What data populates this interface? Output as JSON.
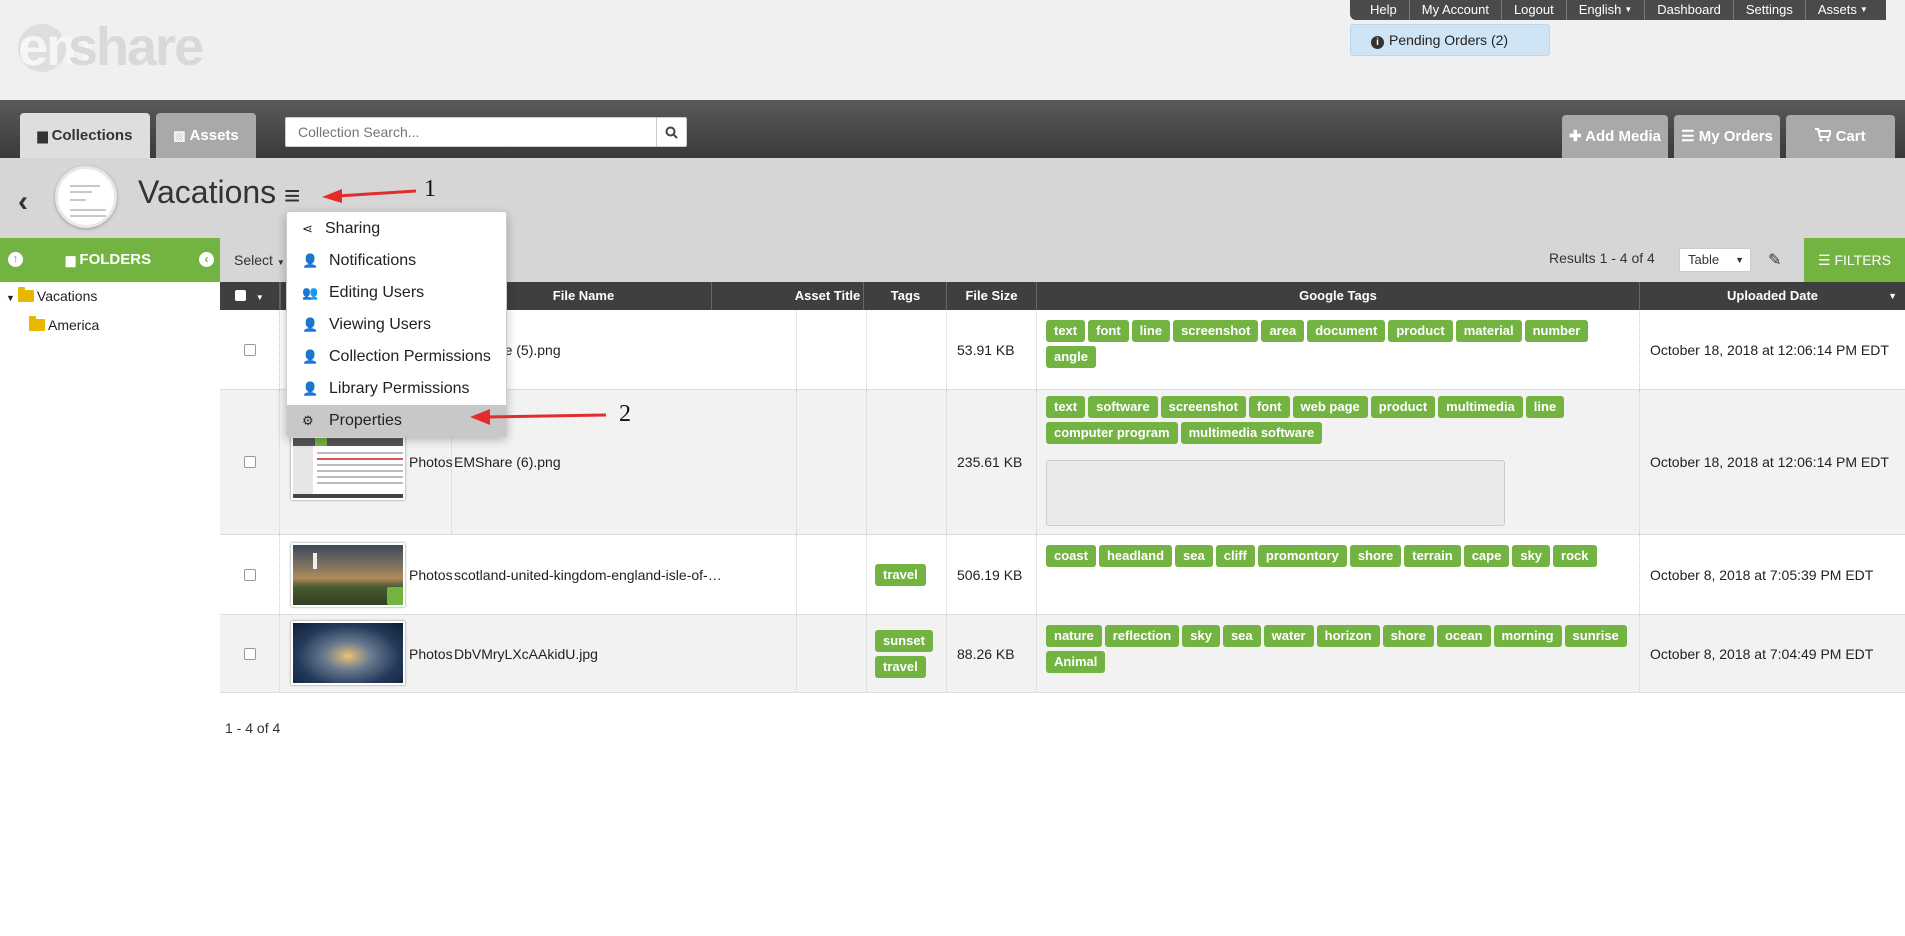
{
  "brand": {
    "logo_text": "share",
    "logo_e": "em"
  },
  "topnav": {
    "items": [
      {
        "label": "Help"
      },
      {
        "label": "My Account"
      },
      {
        "label": "Logout"
      },
      {
        "label": "English"
      },
      {
        "label": "Dashboard"
      },
      {
        "label": "Settings"
      },
      {
        "label": "Assets"
      }
    ],
    "pending_orders": "Pending Orders (2)"
  },
  "toolbar": {
    "tab_collections": "Collections",
    "tab_assets": "Assets",
    "search_placeholder": "Collection Search...",
    "add_media": "Add Media",
    "my_orders": "My Orders",
    "cart": "Cart"
  },
  "collection": {
    "title": "Vacations"
  },
  "menu": {
    "items": [
      {
        "label": "Sharing",
        "icon": "share-icon"
      },
      {
        "label": "Notifications",
        "icon": "user-lock-icon"
      },
      {
        "label": "Editing Users",
        "icon": "users-icon"
      },
      {
        "label": "Viewing Users",
        "icon": "user-lock-icon"
      },
      {
        "label": "Collection Permissions",
        "icon": "user-lock-icon"
      },
      {
        "label": "Library Permissions",
        "icon": "user-lock-icon"
      },
      {
        "label": "Properties",
        "icon": "cogs-icon"
      }
    ]
  },
  "sidebar": {
    "folders_label": "FOLDERS",
    "tree": [
      {
        "label": "Vacations"
      },
      {
        "label": "America"
      }
    ]
  },
  "results": {
    "select_label": "Select",
    "summary": "Results 1 - 4 of 4",
    "view_mode": "Table",
    "filters": "FILTERS",
    "footer": "1 - 4 of 4"
  },
  "table": {
    "headers": {
      "file_name": "File Name",
      "asset_title": "Asset Title",
      "tags": "Tags",
      "file_size": "File Size",
      "google_tags": "Google Tags",
      "uploaded_date": "Uploaded Date"
    },
    "rows": [
      {
        "type": "",
        "file_name": "EMShare (5).png",
        "tags": [],
        "file_size": "53.91 KB",
        "google_tags": [
          "text",
          "font",
          "line",
          "screenshot",
          "area",
          "document",
          "product",
          "material",
          "number",
          "angle"
        ],
        "uploaded": "October 18, 2018 at 12:06:14 PM EDT"
      },
      {
        "type": "Photos",
        "file_name": "EMShare (6).png",
        "tags": [],
        "file_size": "235.61 KB",
        "google_tags": [
          "text",
          "software",
          "screenshot",
          "font",
          "web page",
          "product",
          "multimedia",
          "line",
          "computer program",
          "multimedia software"
        ],
        "uploaded": "October 18, 2018 at 12:06:14 PM EDT"
      },
      {
        "type": "Photos",
        "file_name": "scotland-united-kingdom-england-isle-of-…",
        "tags": [
          "travel"
        ],
        "file_size": "506.19 KB",
        "google_tags": [
          "coast",
          "headland",
          "sea",
          "cliff",
          "promontory",
          "shore",
          "terrain",
          "cape",
          "sky",
          "rock"
        ],
        "uploaded": "October 8, 2018 at 7:05:39 PM EDT"
      },
      {
        "type": "Photos",
        "file_name": "DbVMryLXcAAkidU.jpg",
        "tags": [
          "sunset",
          "travel"
        ],
        "file_size": "88.26 KB",
        "google_tags": [
          "nature",
          "reflection",
          "sky",
          "sea",
          "water",
          "horizon",
          "shore",
          "ocean",
          "morning",
          "sunrise",
          "Animal"
        ],
        "uploaded": "October 8, 2018 at 7:04:49 PM EDT"
      }
    ]
  },
  "annotations": {
    "one": "1",
    "two": "2"
  },
  "colors": {
    "accent_green": "#73b342",
    "arrow_red": "#e52c2c",
    "toolbar_dark": "#3f3f3f"
  }
}
